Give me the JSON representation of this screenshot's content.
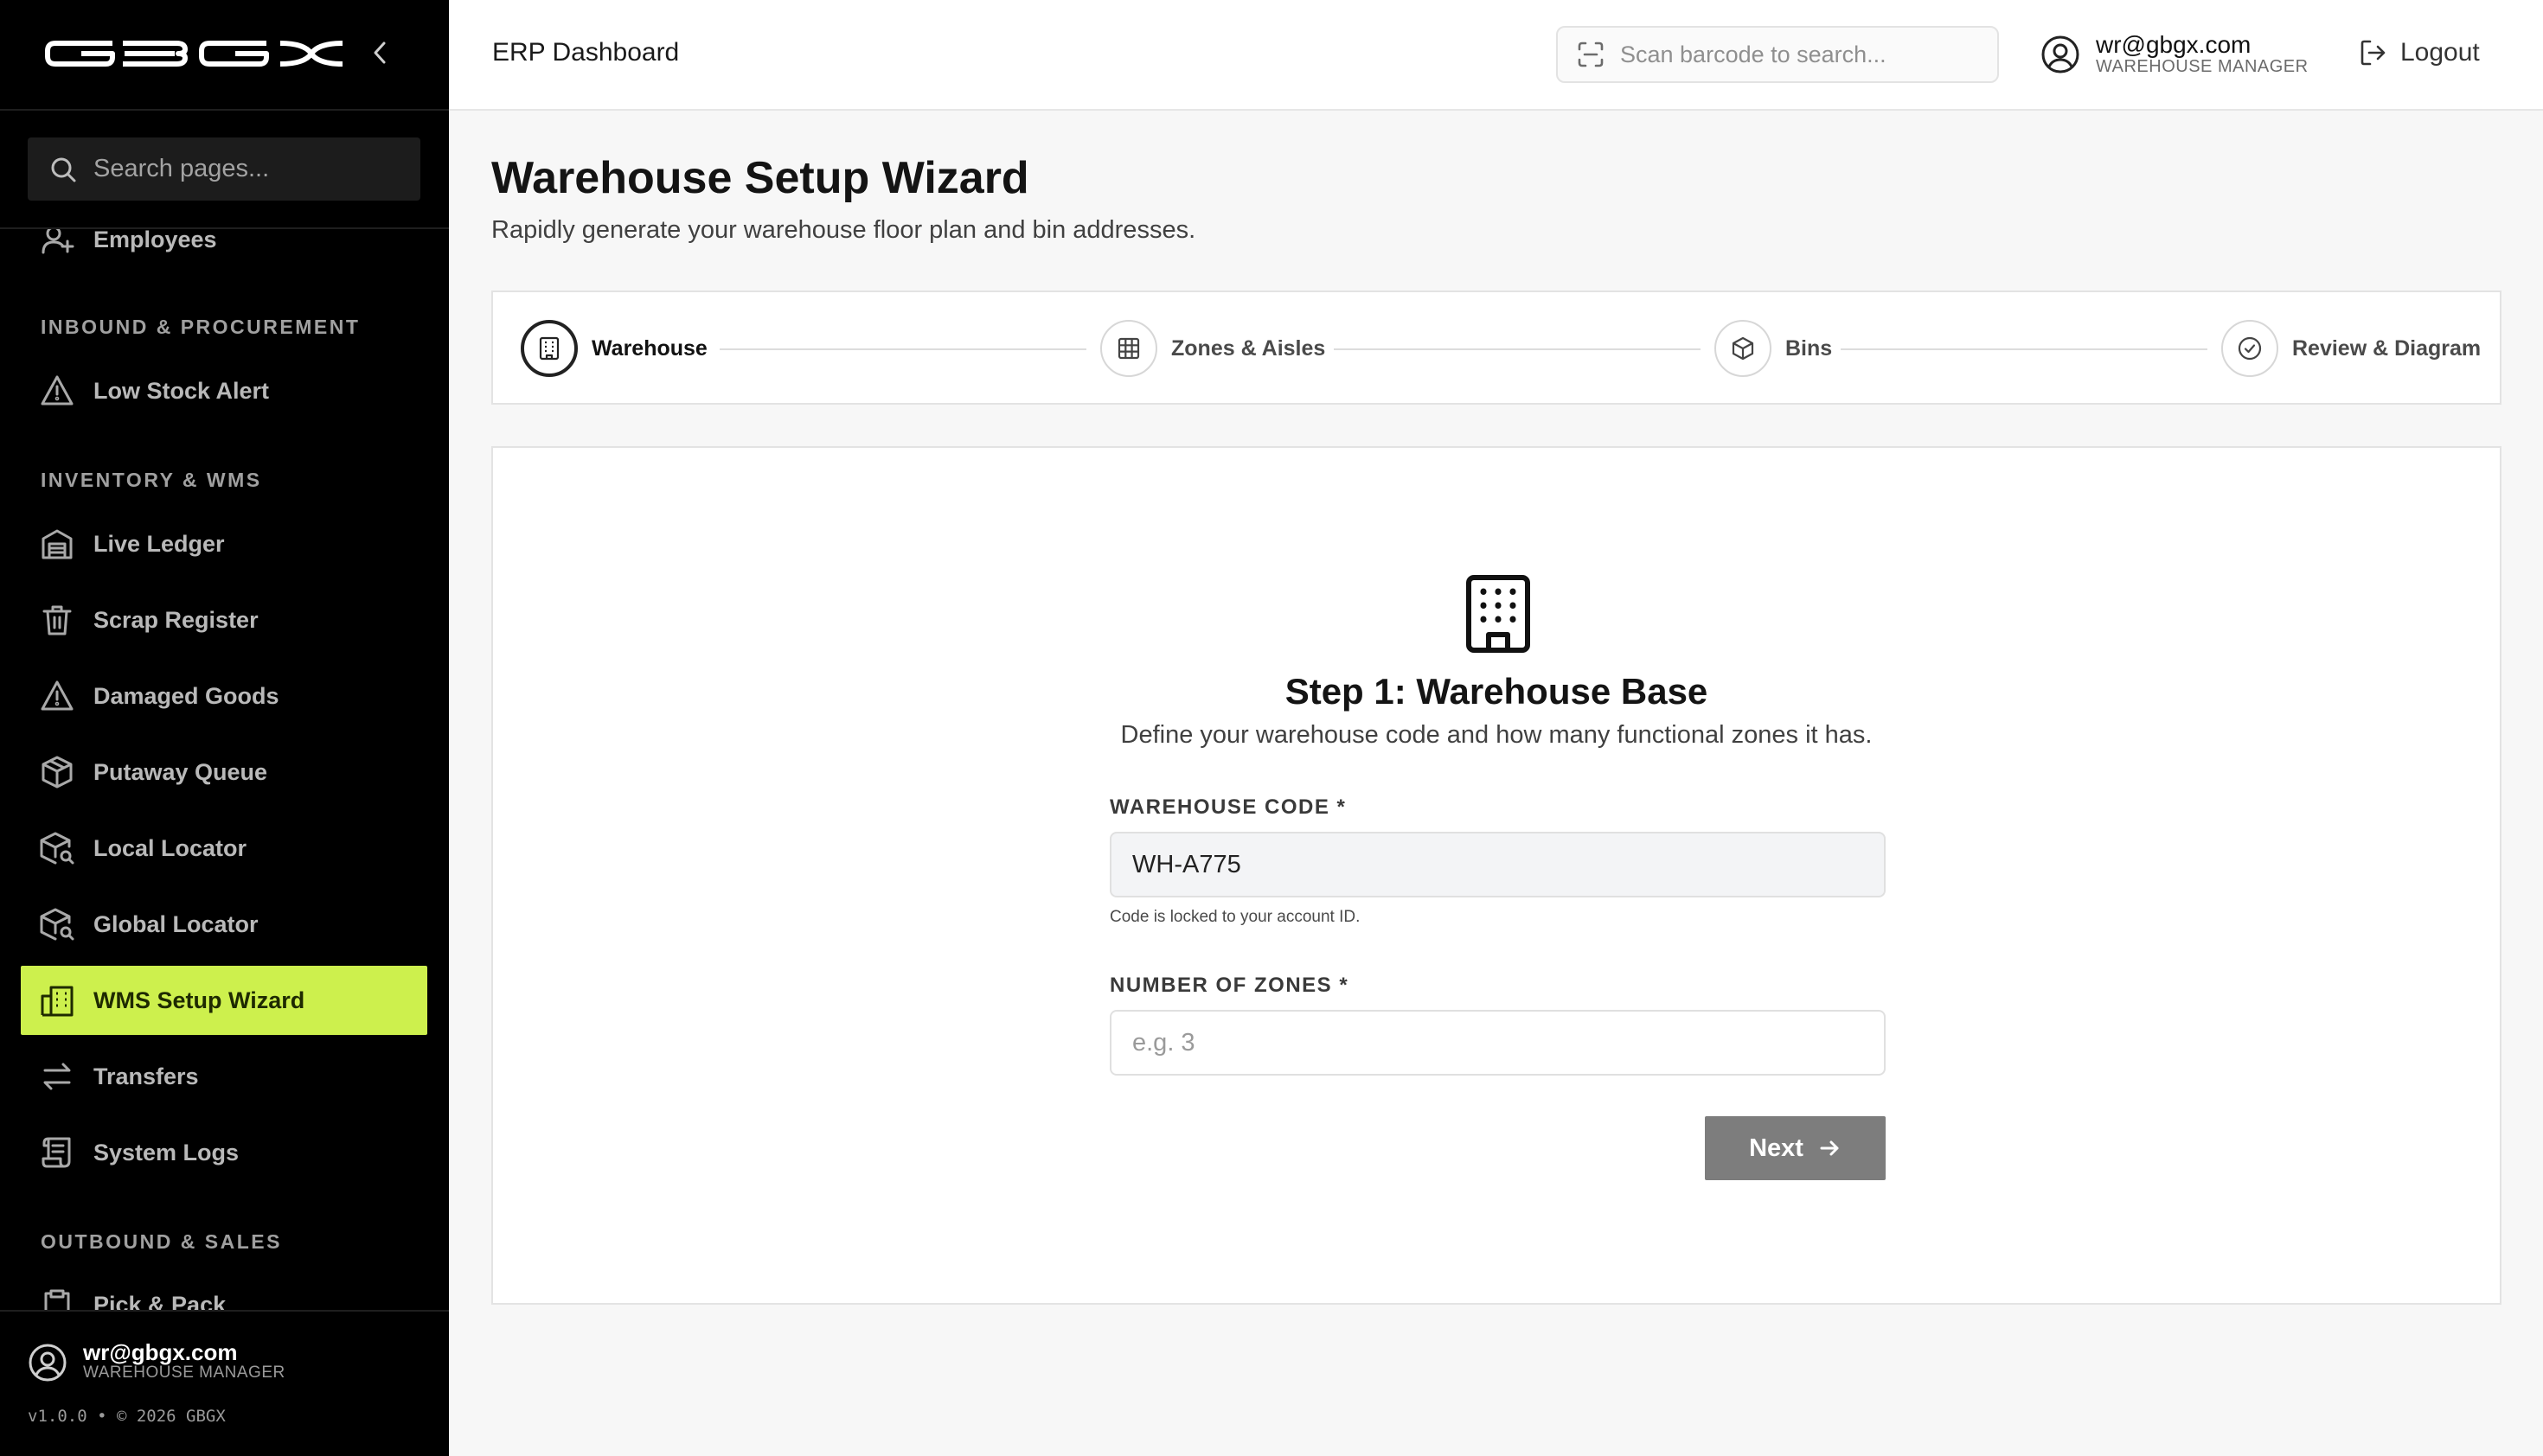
{
  "brand": {
    "logo_text": "GBGX"
  },
  "sidebar": {
    "search_placeholder": "Search pages...",
    "partial_top_item": "Employees",
    "sections": [
      {
        "heading": "INBOUND & PROCUREMENT",
        "items": [
          "Low Stock Alert"
        ]
      },
      {
        "heading": "INVENTORY & WMS",
        "items": [
          "Live Ledger",
          "Scrap Register",
          "Damaged Goods",
          "Putaway Queue",
          "Local Locator",
          "Global Locator",
          "WMS Setup Wizard",
          "Transfers",
          "System Logs"
        ]
      },
      {
        "heading": "OUTBOUND & SALES",
        "items": [
          "Pick & Pack"
        ]
      }
    ],
    "active_item": "WMS Setup Wizard",
    "user": {
      "email": "wr@gbgx.com",
      "role": "WAREHOUSE MANAGER"
    },
    "version": "v1.0.0 • © 2026 GBGX"
  },
  "header": {
    "title": "ERP Dashboard",
    "scan_placeholder": "Scan barcode to search...",
    "user": {
      "email": "wr@gbgx.com",
      "role": "WAREHOUSE MANAGER"
    },
    "logout_label": "Logout"
  },
  "page": {
    "title": "Warehouse Setup Wizard",
    "subtitle": "Rapidly generate your warehouse floor plan and bin addresses."
  },
  "stepper": {
    "current_step": 1,
    "steps": [
      {
        "label": "Warehouse",
        "icon": "building-icon"
      },
      {
        "label": "Zones & Aisles",
        "icon": "grid-icon"
      },
      {
        "label": "Bins",
        "icon": "box-icon"
      },
      {
        "label": "Review & Diagram",
        "icon": "check-circle-icon"
      }
    ]
  },
  "form": {
    "icon": "building-icon",
    "title": "Step 1: Warehouse Base",
    "subtitle": "Define your warehouse code and how many functional zones it has.",
    "warehouse_code": {
      "label": "WAREHOUSE CODE *",
      "value": "WH-A775",
      "hint": "Code is locked to your account ID."
    },
    "zones": {
      "label": "NUMBER OF ZONES *",
      "value": "",
      "placeholder": "e.g. 3"
    },
    "next_label": "Next"
  },
  "colors": {
    "accent": "#CDF04D",
    "sidebar_bg": "#000000",
    "button_disabled": "#7D7D7D"
  }
}
